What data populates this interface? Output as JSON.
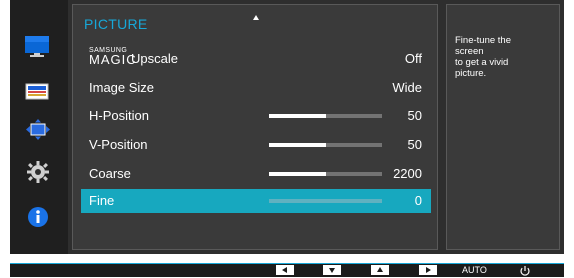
{
  "sidebar": {
    "icons": [
      {
        "name": "picture-icon",
        "active": true
      },
      {
        "name": "color-icon"
      },
      {
        "name": "size-position-icon"
      },
      {
        "name": "setup-icon"
      },
      {
        "name": "information-icon"
      }
    ]
  },
  "menu": {
    "title": "PICTURE",
    "rows": [
      {
        "brand_top": "SAMSUNG",
        "brand_bottom": "MAGIC",
        "label": "Upscale",
        "value": "Off"
      },
      {
        "label": "Image Size",
        "value": "Wide"
      },
      {
        "label": "H-Position",
        "value": "50",
        "level": 0.5
      },
      {
        "label": "V-Position",
        "value": "50",
        "level": 0.5
      },
      {
        "label": "Coarse",
        "value": "2200",
        "level": 0.5
      },
      {
        "label": "Fine",
        "value": "0",
        "level": 0,
        "selected": true
      }
    ]
  },
  "help": {
    "text": "Fine-tune the screen to get a vivid picture.",
    "lines": [
      "Fine-tune the",
      "screen",
      "to get a vivid",
      "picture."
    ]
  },
  "keybar": {
    "keys": [
      "left",
      "down",
      "up",
      "right"
    ],
    "auto_label": "AUTO",
    "power_icon": "power-icon"
  },
  "colors": {
    "accent": "#17a8d8",
    "selected_row": "#17a8bf",
    "panel": "#3a3a3a",
    "background": "#2e2e2e"
  }
}
